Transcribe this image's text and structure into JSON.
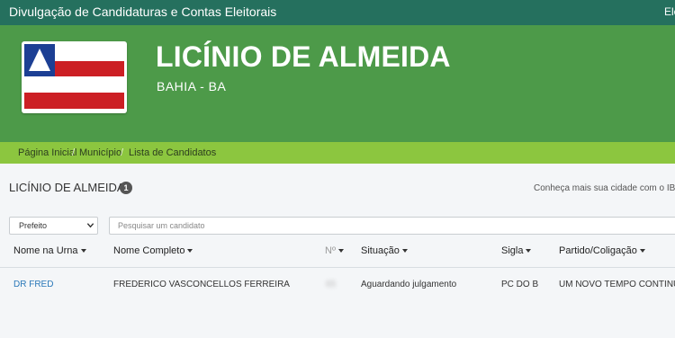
{
  "topbar": {
    "title": "Divulgação de Candidaturas e Contas Eleitorais",
    "right_text": "Ele"
  },
  "hero": {
    "city_name": "LICÍNIO DE ALMEIDA",
    "state": "BAHIA - BA"
  },
  "breadcrumb": {
    "items": [
      {
        "label": "Página Inicial"
      },
      {
        "label": "Município"
      },
      {
        "label": "Lista de Candidatos"
      }
    ],
    "separator": "/"
  },
  "section": {
    "title": "LICÍNIO DE ALMEIDA -",
    "count": "1",
    "know_more": "Conheça mais sua cidade com o IBGE"
  },
  "filters": {
    "office_selected": "Prefeito",
    "search_placeholder": "Pesquisar um candidato"
  },
  "table": {
    "headers": {
      "ballot_name": "Nome na Urna",
      "full_name": "Nome Completo",
      "number": "Nº",
      "status": "Situação",
      "party": "Sigla",
      "coalition": "Partido/Coligação"
    },
    "rows": [
      {
        "ballot_name": "DR FRED",
        "full_name": "FREDERICO VASCONCELLOS FERREIRA",
        "number": "65",
        "status": "Aguardando julgamento",
        "party": "PC DO B",
        "coalition": "UM NOVO TEMPO CONTINUA"
      }
    ]
  },
  "colors": {
    "topbar": "#25705e",
    "hero": "#4d9a49",
    "breadcrumb": "#8cc63f",
    "link": "#2a78b8",
    "flag_red": "#cc1f24",
    "flag_blue": "#1c3f94"
  },
  "icons": {
    "flag": "bahia-flag",
    "sort": "sort-caret-down-icon"
  }
}
